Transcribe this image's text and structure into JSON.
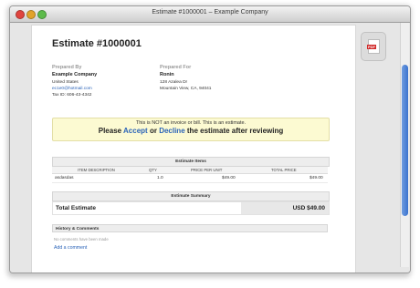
{
  "window": {
    "title": "Estimate #1000001 – Example Company"
  },
  "doc": {
    "title": "Estimate #1000001",
    "prepared_by": {
      "label": "Prepared By",
      "name": "Example Company",
      "line1": "United States",
      "email": "ec1e0@hotmail.com",
      "tax": "Tax ID: 606-43-4342"
    },
    "prepared_for": {
      "label": "Prepared For",
      "name": "Ronin",
      "line1": "128 Azalea Dr",
      "line2": "Mountain View, CA, 94041"
    },
    "notice": {
      "line1": "This is NOT an invoice or bill. This is an estimate.",
      "please": "Please",
      "accept": "Accept",
      "or": "or",
      "decline": "Decline",
      "rest": "the estimate after reviewing"
    },
    "items": {
      "title": "Estimate Items",
      "headers": [
        "ITEM DESCRIPTION",
        "QTY",
        "PRICE PER UNIT",
        "TOTAL PRICE"
      ],
      "rows": [
        {
          "desc": "asdasdas",
          "qty": "1.0",
          "price": "$49.00",
          "total": "$49.00"
        }
      ]
    },
    "summary": {
      "title": "Estimate Summary",
      "label": "Total Estimate",
      "value": "USD $49.00"
    },
    "history": {
      "title": "History & Comments",
      "empty": "No comments have been made",
      "add": "Add a comment"
    }
  },
  "colors": {
    "accent": "#2a63b8",
    "notice_bg": "#fcfad2",
    "scroll_thumb": "#3b73cf"
  },
  "icons": {
    "pdf": "pdf-icon"
  }
}
